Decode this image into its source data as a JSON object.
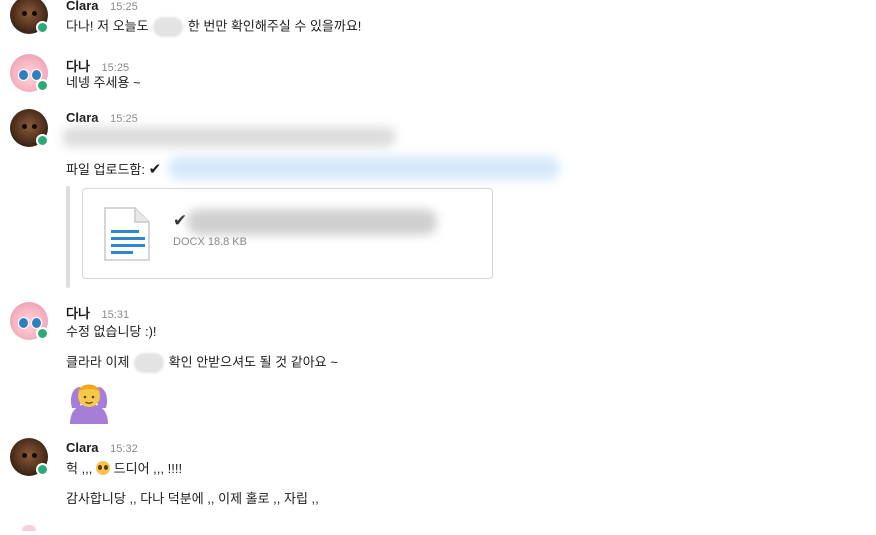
{
  "messages": [
    {
      "author": "Clara",
      "time": "15:25",
      "lines": [
        {
          "before": "다나! 저 오늘도",
          "after": "한 번만 확인해주실 수 있을까요!"
        }
      ]
    },
    {
      "author": "다나",
      "time": "15:25",
      "lines": [
        {
          "text": "네넹 주세용 ~"
        }
      ]
    },
    {
      "author": "Clara",
      "time": "15:25",
      "upload_label": "파일 업로드함:",
      "check_glyph": "✔",
      "file": {
        "check_glyph": "✔",
        "meta": "DOCX 18.8 KB"
      }
    },
    {
      "author": "다나",
      "time": "15:31",
      "lines": [
        {
          "text": "수정 없습니당 :)!"
        },
        {
          "before": "클라라 이제",
          "after": "확인 안받으셔도 될 것 같아요 ~"
        }
      ]
    },
    {
      "author": "Clara",
      "time": "15:32",
      "lines": [
        {
          "before": "헉 ,,,",
          "after": "드디어 ,,, !!!!"
        },
        {
          "text": "감사합니당 ,, 다나 덕분에 ,, 이제 홀로 ,, 자립 ,,"
        }
      ]
    }
  ],
  "colors": {
    "presence": "#2bac76",
    "timestamp": "#8a8a8a",
    "link_blur": "#cfe3f7",
    "doc_icon_blue": "#2f86d1"
  },
  "icons": {
    "file": "docx-file-icon",
    "presence": "presence-dot-icon",
    "reaction_emoji": "woman-gesturing-ok-emoji",
    "inline_emoji": "pleading-face-emoji"
  }
}
